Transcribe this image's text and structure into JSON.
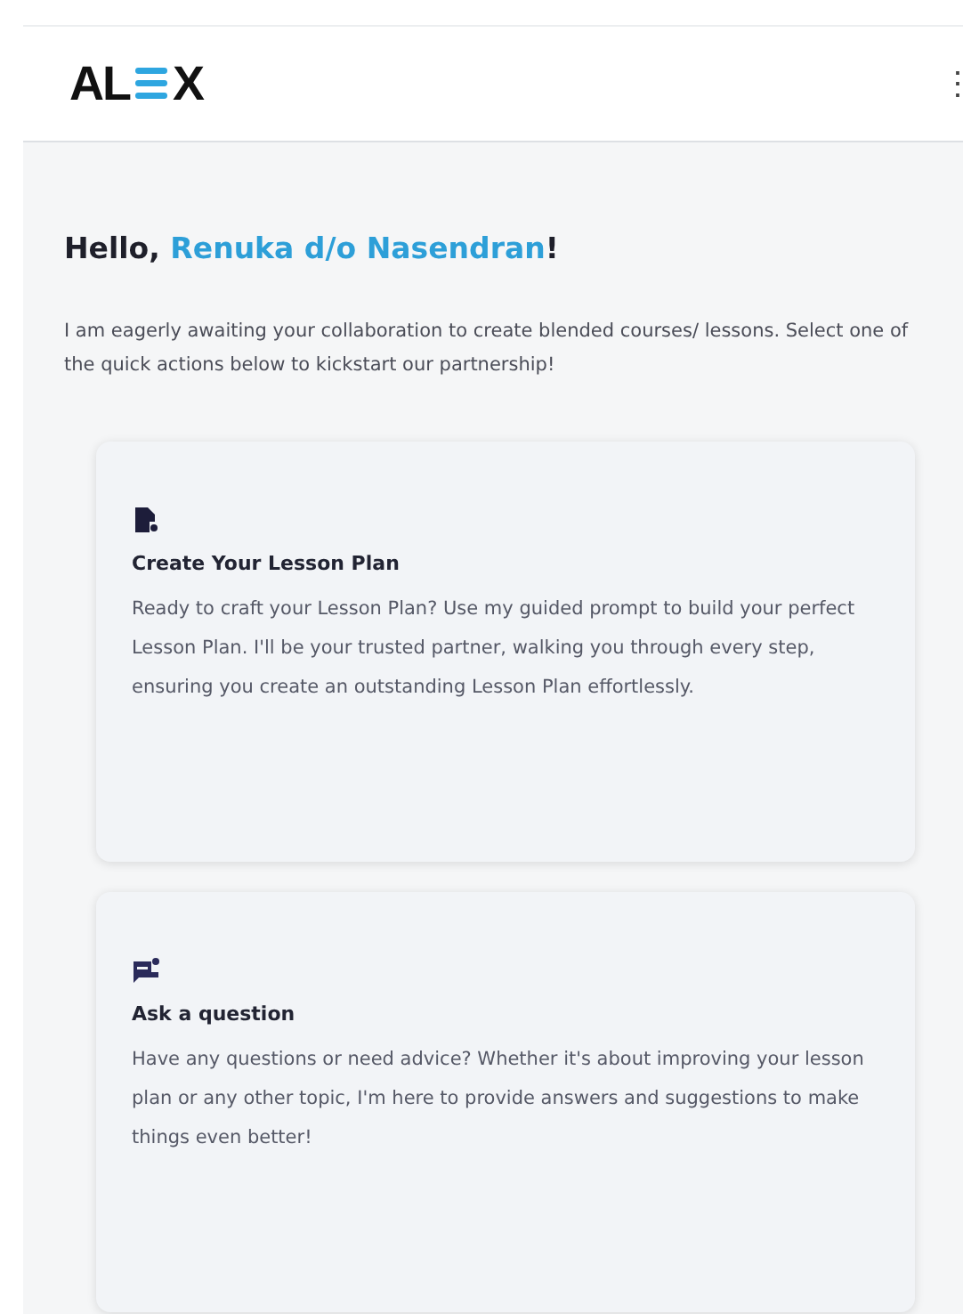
{
  "header": {
    "logo": {
      "left": "AL",
      "right": "X"
    },
    "menu_icon": "⋮"
  },
  "greeting": {
    "prefix": "Hello, ",
    "name": "Renuka d/o Nasendran",
    "suffix": "!"
  },
  "intro": "I am eagerly awaiting your collaboration to create blended courses/ lessons. Select one of the quick actions below to kickstart our partnership!",
  "actions": [
    {
      "kind": "document",
      "title": "Create Your Lesson Plan",
      "description": "Ready to craft your Lesson Plan? Use my guided prompt to build your perfect Lesson Plan. I'll be your trusted partner, walking you through every step, ensuring you create an outstanding Lesson Plan effortlessly."
    },
    {
      "kind": "chat",
      "title": "Ask a question",
      "description": "Have any questions or need advice? Whether it's about improving your lesson plan or any other topic, I'm here to provide answers and suggestions to make things even better!"
    }
  ]
}
